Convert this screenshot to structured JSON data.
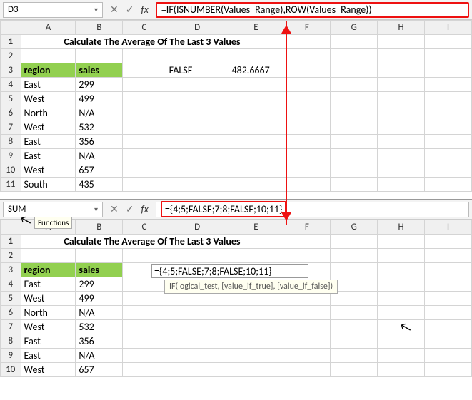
{
  "top": {
    "nameBox": "D3",
    "formulaText": "=IF(ISNUMBER(Values_Range),ROW(Values_Range))",
    "columns": [
      "A",
      "B",
      "C",
      "D",
      "E",
      "F",
      "G",
      "H",
      "I"
    ],
    "title": "Calculate The Average Of The Last 3 Values",
    "headers": {
      "region": "region",
      "sales": "sales"
    },
    "d3": "FALSE",
    "e3": "482.6667",
    "rows": [
      {
        "n": 4,
        "a": "East",
        "b": "299"
      },
      {
        "n": 5,
        "a": "West",
        "b": "499"
      },
      {
        "n": 6,
        "a": "North",
        "b": "N/A"
      },
      {
        "n": 7,
        "a": "West",
        "b": "532"
      },
      {
        "n": 8,
        "a": "East",
        "b": "356"
      },
      {
        "n": 9,
        "a": "East",
        "b": "N/A"
      },
      {
        "n": 10,
        "a": "West",
        "b": "657"
      },
      {
        "n": 11,
        "a": "South",
        "b": "435"
      }
    ]
  },
  "bottom": {
    "nameBox": "SUM",
    "nameTooltip": "Functions",
    "formulaText": "={4;5;FALSE;7;8;FALSE;10;11}",
    "columns": [
      "A",
      "B",
      "C",
      "D",
      "E",
      "F",
      "G",
      "H",
      "I"
    ],
    "title": "Calculate The Average Of The Last 3 Values",
    "headers": {
      "region": "region",
      "sales": "sales"
    },
    "editText": "={4;5;FALSE;7;8;FALSE;10;11}",
    "fnHint": "IF(logical_test, [value_if_true], [value_if_false])",
    "rows": [
      {
        "n": 4,
        "a": "East",
        "b": "299"
      },
      {
        "n": 5,
        "a": "West",
        "b": "499"
      },
      {
        "n": 6,
        "a": "North",
        "b": "N/A"
      },
      {
        "n": 7,
        "a": "West",
        "b": "532"
      },
      {
        "n": 8,
        "a": "East",
        "b": "356"
      },
      {
        "n": 9,
        "a": "East",
        "b": "N/A"
      },
      {
        "n": 10,
        "a": "West",
        "b": "657"
      }
    ]
  },
  "icons": {
    "cancel": "✕",
    "enter": "✓",
    "fx": "fx",
    "dd": "▾",
    "cursor": "↖"
  }
}
